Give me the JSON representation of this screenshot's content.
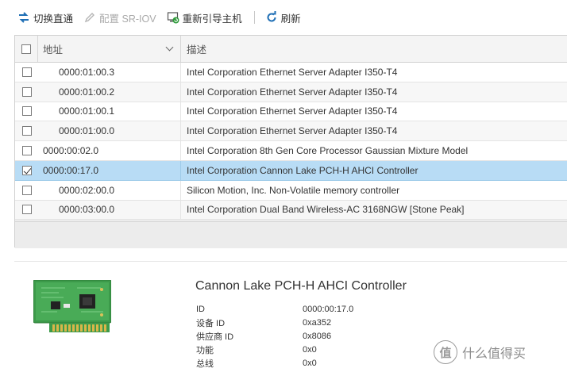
{
  "toolbar": {
    "passthrough_label": "切换直通",
    "sriov_label": "配置 SR-IOV",
    "reboot_label": "重新引导主机",
    "refresh_label": "刷新"
  },
  "grid": {
    "columns": {
      "address": "地址",
      "description": "描述"
    },
    "rows": [
      {
        "address": "0000:01:00.3",
        "description": "Intel Corporation Ethernet Server Adapter I350-T4",
        "checked": false
      },
      {
        "address": "0000:01:00.2",
        "description": "Intel Corporation Ethernet Server Adapter I350-T4",
        "checked": false
      },
      {
        "address": "0000:01:00.1",
        "description": "Intel Corporation Ethernet Server Adapter I350-T4",
        "checked": false
      },
      {
        "address": "0000:01:00.0",
        "description": "Intel Corporation Ethernet Server Adapter I350-T4",
        "checked": false
      },
      {
        "address": "0000:00:02.0",
        "description": "Intel Corporation 8th Gen Core Processor Gaussian Mixture Model",
        "checked": false
      },
      {
        "address": "0000:00:17.0",
        "description": "Intel Corporation Cannon Lake PCH-H AHCI Controller",
        "checked": true
      },
      {
        "address": "0000:02:00.0",
        "description": "Silicon Motion, Inc. Non-Volatile memory controller",
        "checked": false
      },
      {
        "address": "0000:03:00.0",
        "description": "Intel Corporation Dual Band Wireless-AC 3168NGW [Stone Peak]",
        "checked": false
      }
    ]
  },
  "details": {
    "title": "Cannon Lake PCH-H AHCI Controller",
    "properties": [
      {
        "key": "ID",
        "value": "0000:00:17.0"
      },
      {
        "key": "设备 ID",
        "value": "0xa352"
      },
      {
        "key": "供应商 ID",
        "value": "0x8086"
      },
      {
        "key": "功能",
        "value": "0x0"
      },
      {
        "key": "总线",
        "value": "0x0"
      }
    ]
  },
  "watermark": {
    "text": "什么值得买",
    "icon_glyph": "值"
  },
  "colors": {
    "selected_row": "#b8dcf5",
    "accent_blue": "#1f6fb5",
    "pcb_green": "#3c9a4a"
  }
}
